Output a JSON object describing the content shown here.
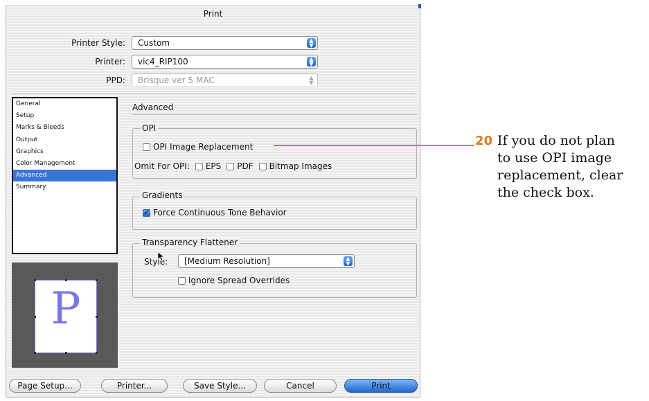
{
  "dialog": {
    "title": "Print",
    "printer_style_label": "Printer Style:",
    "printer_style_value": "Custom",
    "printer_label": "Printer:",
    "printer_value": "vic4_RIP100",
    "ppd_label": "PPD:",
    "ppd_value": "Brisque ver 5 MAC"
  },
  "sidebar": {
    "items": [
      {
        "label": "General"
      },
      {
        "label": "Setup"
      },
      {
        "label": "Marks & Bleeds"
      },
      {
        "label": "Output"
      },
      {
        "label": "Graphics"
      },
      {
        "label": "Color Management"
      },
      {
        "label": "Advanced",
        "selected": true
      },
      {
        "label": "Summary"
      }
    ]
  },
  "preview": {
    "letter": "P"
  },
  "advanced": {
    "title": "Advanced",
    "opi": {
      "group_label": "OPI",
      "image_replacement_label": "OPI Image Replacement",
      "image_replacement_checked": false,
      "omit_label": "Omit For OPI:",
      "omit_eps": "EPS",
      "omit_pdf": "PDF",
      "omit_bitmap": "Bitmap Images"
    },
    "gradients": {
      "group_label": "Gradients",
      "force_continuous_label": "Force Continuous Tone Behavior",
      "force_continuous_checked": true
    },
    "transparency": {
      "group_label": "Transparency Flattener",
      "style_label": "Style:",
      "style_value": "[Medium Resolution]",
      "ignore_spread_label": "Ignore Spread Overrides"
    }
  },
  "buttons": {
    "page_setup": "Page Setup...",
    "printer": "Printer...",
    "save_style": "Save Style...",
    "cancel": "Cancel",
    "print": "Print"
  },
  "callout": {
    "number": "20",
    "line1": "If you do not plan",
    "line2": "to use OPI image",
    "line3": "replacement, clear",
    "line4": "the check box.",
    "color": "#e07b24"
  },
  "icons": [
    "popup-arrows-icon",
    "checkbox-icon",
    "arrow-cursor-icon"
  ],
  "colors": {
    "selection": "#3875d7",
    "accent": "#1e62c8"
  }
}
